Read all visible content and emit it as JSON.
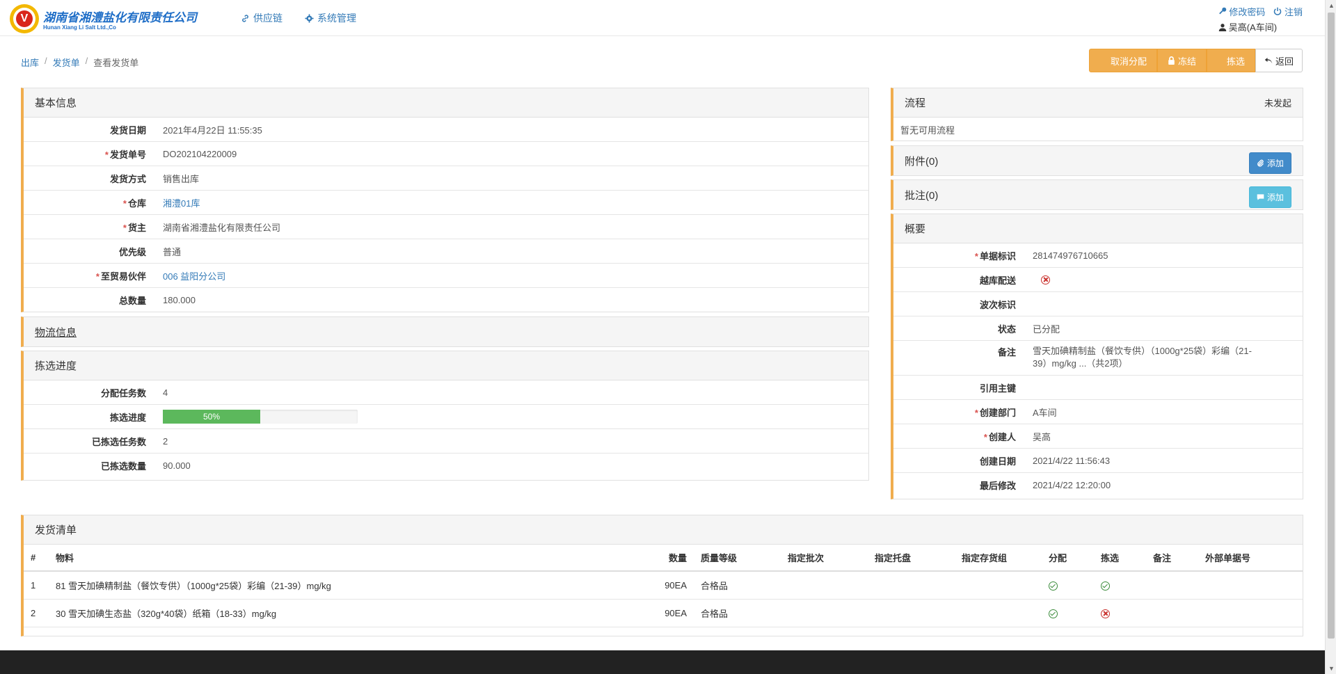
{
  "brand": {
    "logo_char": "V",
    "name_cn": "湖南省湘澧盐化有限责任公司",
    "name_en": "Hunan Xiang Li Salt Ltd.,Co"
  },
  "nav": {
    "items": [
      {
        "label": "供应链",
        "icon": "link-icon"
      },
      {
        "label": "系统管理",
        "icon": "gear-icon"
      }
    ],
    "change_password": "修改密码",
    "logout": "注销",
    "user": "吴高(A车间)"
  },
  "breadcrumb": [
    "出库",
    "发货单",
    "查看发货单"
  ],
  "actions": {
    "cancel_alloc": "取消分配",
    "freeze": "冻结",
    "pick": "拣选",
    "back": "返回"
  },
  "basic_info": {
    "title": "基本信息",
    "rows": [
      {
        "label": "发货日期",
        "value": "2021年4月22日 11:55:35",
        "required": false,
        "link": false
      },
      {
        "label": "发货单号",
        "value": "DO202104220009",
        "required": true,
        "link": false
      },
      {
        "label": "发货方式",
        "value": "销售出库",
        "required": false,
        "link": false
      },
      {
        "label": "仓库",
        "value": "湘澧01库",
        "required": true,
        "link": true
      },
      {
        "label": "货主",
        "value": "湖南省湘澧盐化有限责任公司",
        "required": true,
        "link": false
      },
      {
        "label": "优先级",
        "value": "普通",
        "required": false,
        "link": false
      },
      {
        "label": "至贸易伙伴",
        "value": "006 益阳分公司",
        "required": true,
        "link": true
      },
      {
        "label": "总数量",
        "value": "180.000",
        "required": false,
        "link": false
      }
    ]
  },
  "logistics": {
    "title": "物流信息"
  },
  "pick_progress": {
    "title": "拣选进度",
    "assigned_label": "分配任务数",
    "assigned_value": "4",
    "progress_label": "拣选进度",
    "progress_text": "50%",
    "progress_value": 0.5,
    "picked_tasks_label": "已拣选任务数",
    "picked_tasks_value": "2",
    "picked_qty_label": "已拣选数量",
    "picked_qty_value": "90.000"
  },
  "flow": {
    "title": "流程",
    "status": "未发起",
    "empty": "暂无可用流程"
  },
  "attachments": {
    "title": "附件(0)",
    "add": "添加"
  },
  "notes": {
    "title": "批注(0)",
    "add": "添加"
  },
  "summary": {
    "title": "概要",
    "rows": [
      {
        "label": "单据标识",
        "value": "281474976710665",
        "required": true,
        "icon": ""
      },
      {
        "label": "越库配送",
        "value": "",
        "required": false,
        "icon": "x-circle-icon"
      },
      {
        "label": "波次标识",
        "value": "",
        "required": false,
        "icon": ""
      },
      {
        "label": "状态",
        "value": "已分配",
        "required": false,
        "icon": ""
      },
      {
        "label": "备注",
        "value": "雪天加碘精制盐（餐饮专供）（1000g*25袋）彩编（21-39）mg/kg ...（共2项）",
        "required": false,
        "icon": ""
      },
      {
        "label": "引用主键",
        "value": "",
        "required": false,
        "icon": ""
      },
      {
        "label": "创建部门",
        "value": "A车间",
        "required": true,
        "icon": ""
      },
      {
        "label": "创建人",
        "value": "吴高",
        "required": true,
        "icon": ""
      },
      {
        "label": "创建日期",
        "value": "2021/4/22 11:56:43",
        "required": false,
        "icon": ""
      },
      {
        "label": "最后修改",
        "value": "2021/4/22 12:20:00",
        "required": false,
        "icon": ""
      }
    ]
  },
  "shipment_list": {
    "title": "发货清单",
    "columns": [
      "#",
      "物料",
      "数量",
      "质量等级",
      "指定批次",
      "指定托盘",
      "指定存货组",
      "分配",
      "拣选",
      "备注",
      "外部单据号"
    ],
    "rows": [
      {
        "no": "1",
        "material": "81 雪天加碘精制盐（餐饮专供）（1000g*25袋）彩编（21-39）mg/kg",
        "qty": "90EA",
        "grade": "合格品",
        "batch": "",
        "pallet": "",
        "group": "",
        "alloc": "check",
        "pick": "check",
        "note": "",
        "ext": ""
      },
      {
        "no": "2",
        "material": "30 雪天加碘生态盐（320g*40袋）纸箱（18-33）mg/kg",
        "qty": "90EA",
        "grade": "合格品",
        "batch": "",
        "pallet": "",
        "group": "",
        "alloc": "check",
        "pick": "x",
        "note": "",
        "ext": ""
      }
    ]
  }
}
